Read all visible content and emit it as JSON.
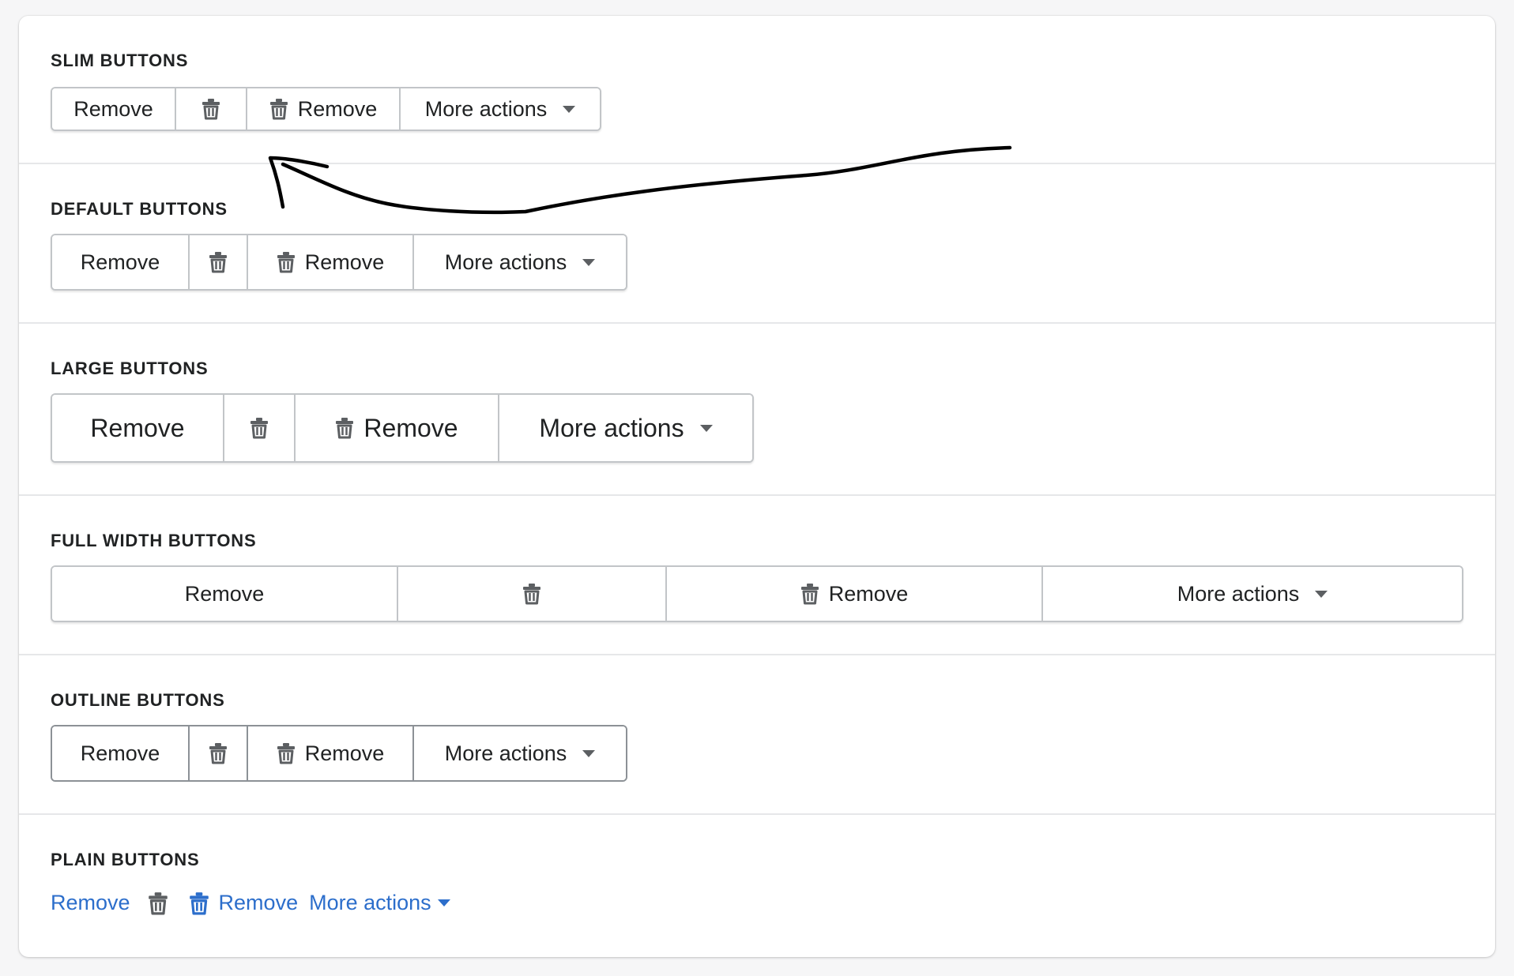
{
  "sections": {
    "slim": {
      "heading": "SLIM BUTTONS"
    },
    "default": {
      "heading": "DEFAULT BUTTONS"
    },
    "large": {
      "heading": "LARGE BUTTONS"
    },
    "full": {
      "heading": "FULL WIDTH BUTTONS"
    },
    "outline": {
      "heading": "OUTLINE BUTTONS"
    },
    "plain": {
      "heading": "PLAIN BUTTONS"
    }
  },
  "buttons": {
    "remove_label": "Remove",
    "more_actions_label": "More actions"
  },
  "icons": {
    "trash": "trash-icon",
    "caret": "caret-down-icon"
  },
  "colors": {
    "plain_link": "#2c6ecb",
    "border": "#c2c5c8",
    "outline_border": "#8c9196",
    "text": "#202223",
    "page_bg": "#f6f6f7"
  }
}
